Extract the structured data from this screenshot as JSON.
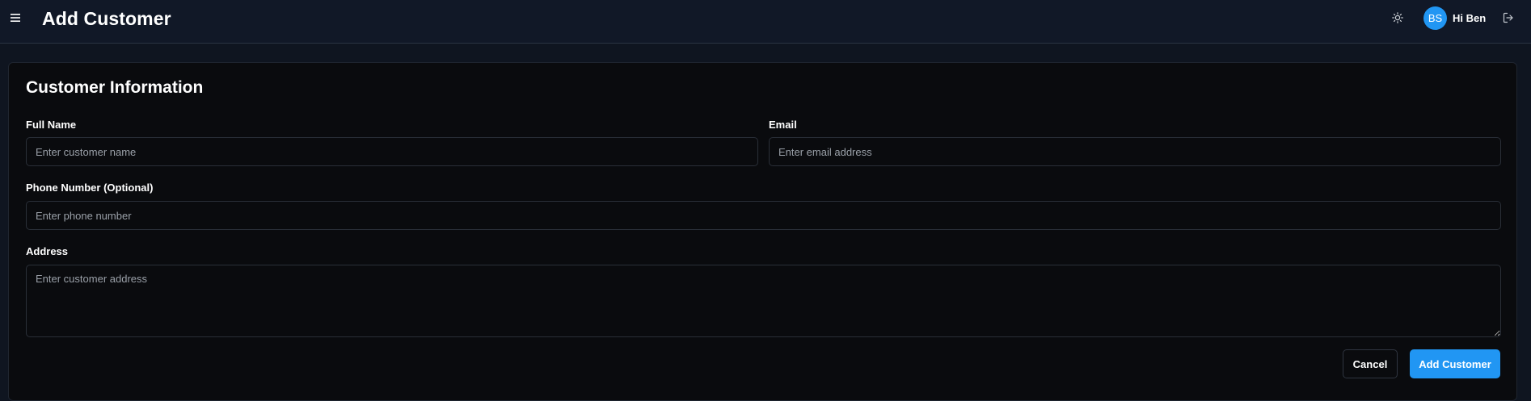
{
  "header": {
    "title": "Add Customer",
    "menu_icon": "hamburger-menu-icon",
    "theme_icon": "sun-icon",
    "user": {
      "initials": "BS",
      "greeting": "Hi Ben",
      "avatar_color": "#2196f3"
    },
    "logout_icon": "logout-icon"
  },
  "form": {
    "title": "Customer Information",
    "fields": {
      "full_name": {
        "label": "Full Name",
        "placeholder": "Enter customer name",
        "value": ""
      },
      "email": {
        "label": "Email",
        "placeholder": "Enter email address",
        "value": ""
      },
      "phone": {
        "label": "Phone Number (Optional)",
        "placeholder": "Enter phone number",
        "value": ""
      },
      "address": {
        "label": "Address",
        "placeholder": "Enter customer address",
        "value": ""
      }
    },
    "actions": {
      "cancel_label": "Cancel",
      "submit_label": "Add Customer"
    }
  },
  "colors": {
    "accent": "#2196f3",
    "background": "#0f1520",
    "card": "#0a0b0e"
  }
}
